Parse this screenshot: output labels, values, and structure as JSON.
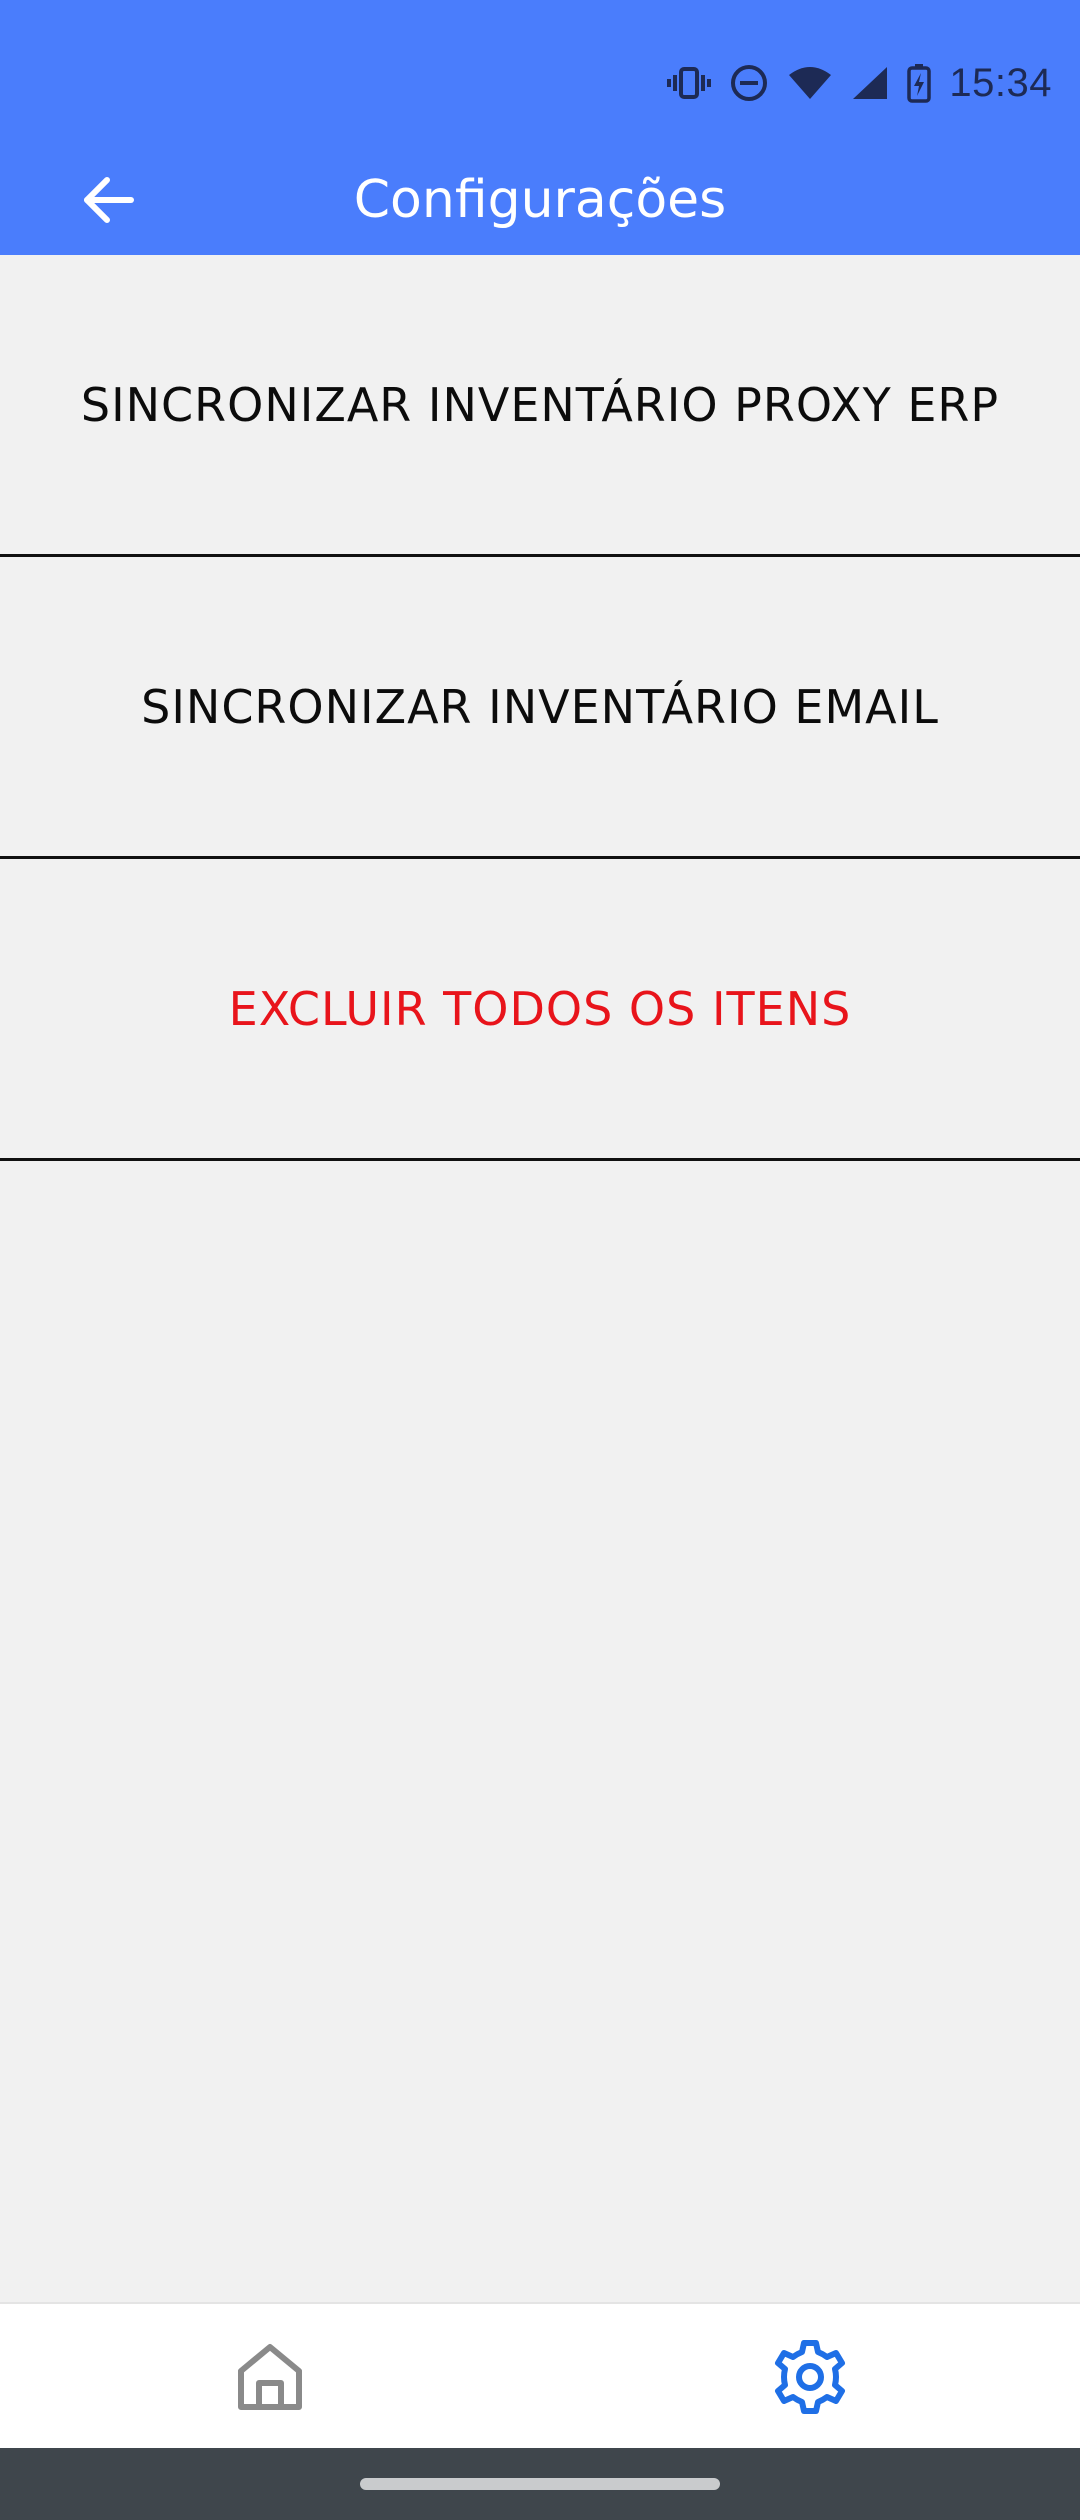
{
  "status_bar": {
    "time": "15:34",
    "icons": [
      "vibrate-icon",
      "do-not-disturb-icon",
      "wifi-icon",
      "cell-signal-icon",
      "battery-charging-icon"
    ]
  },
  "app_bar": {
    "title": "Configurações",
    "back_icon": "arrow-left-icon"
  },
  "menu": {
    "items": [
      {
        "label": "SINCRONIZAR INVENTÁRIO PROXY ERP",
        "color": "#0c0c0c"
      },
      {
        "label": "SINCRONIZAR INVENTÁRIO EMAIL",
        "color": "#0c0c0c"
      },
      {
        "label": "EXCLUIR TODOS OS ITENS",
        "color": "#e8141b"
      }
    ]
  },
  "bottom_nav": {
    "items": [
      {
        "icon": "home-icon",
        "active": false,
        "color": "#8a8a8a"
      },
      {
        "icon": "gear-icon",
        "active": true,
        "color": "#1f6fe6"
      }
    ]
  },
  "colors": {
    "header": "#4a7dfc",
    "background": "#f1f1f1",
    "danger": "#e8141b",
    "accent": "#1f6fe6"
  }
}
